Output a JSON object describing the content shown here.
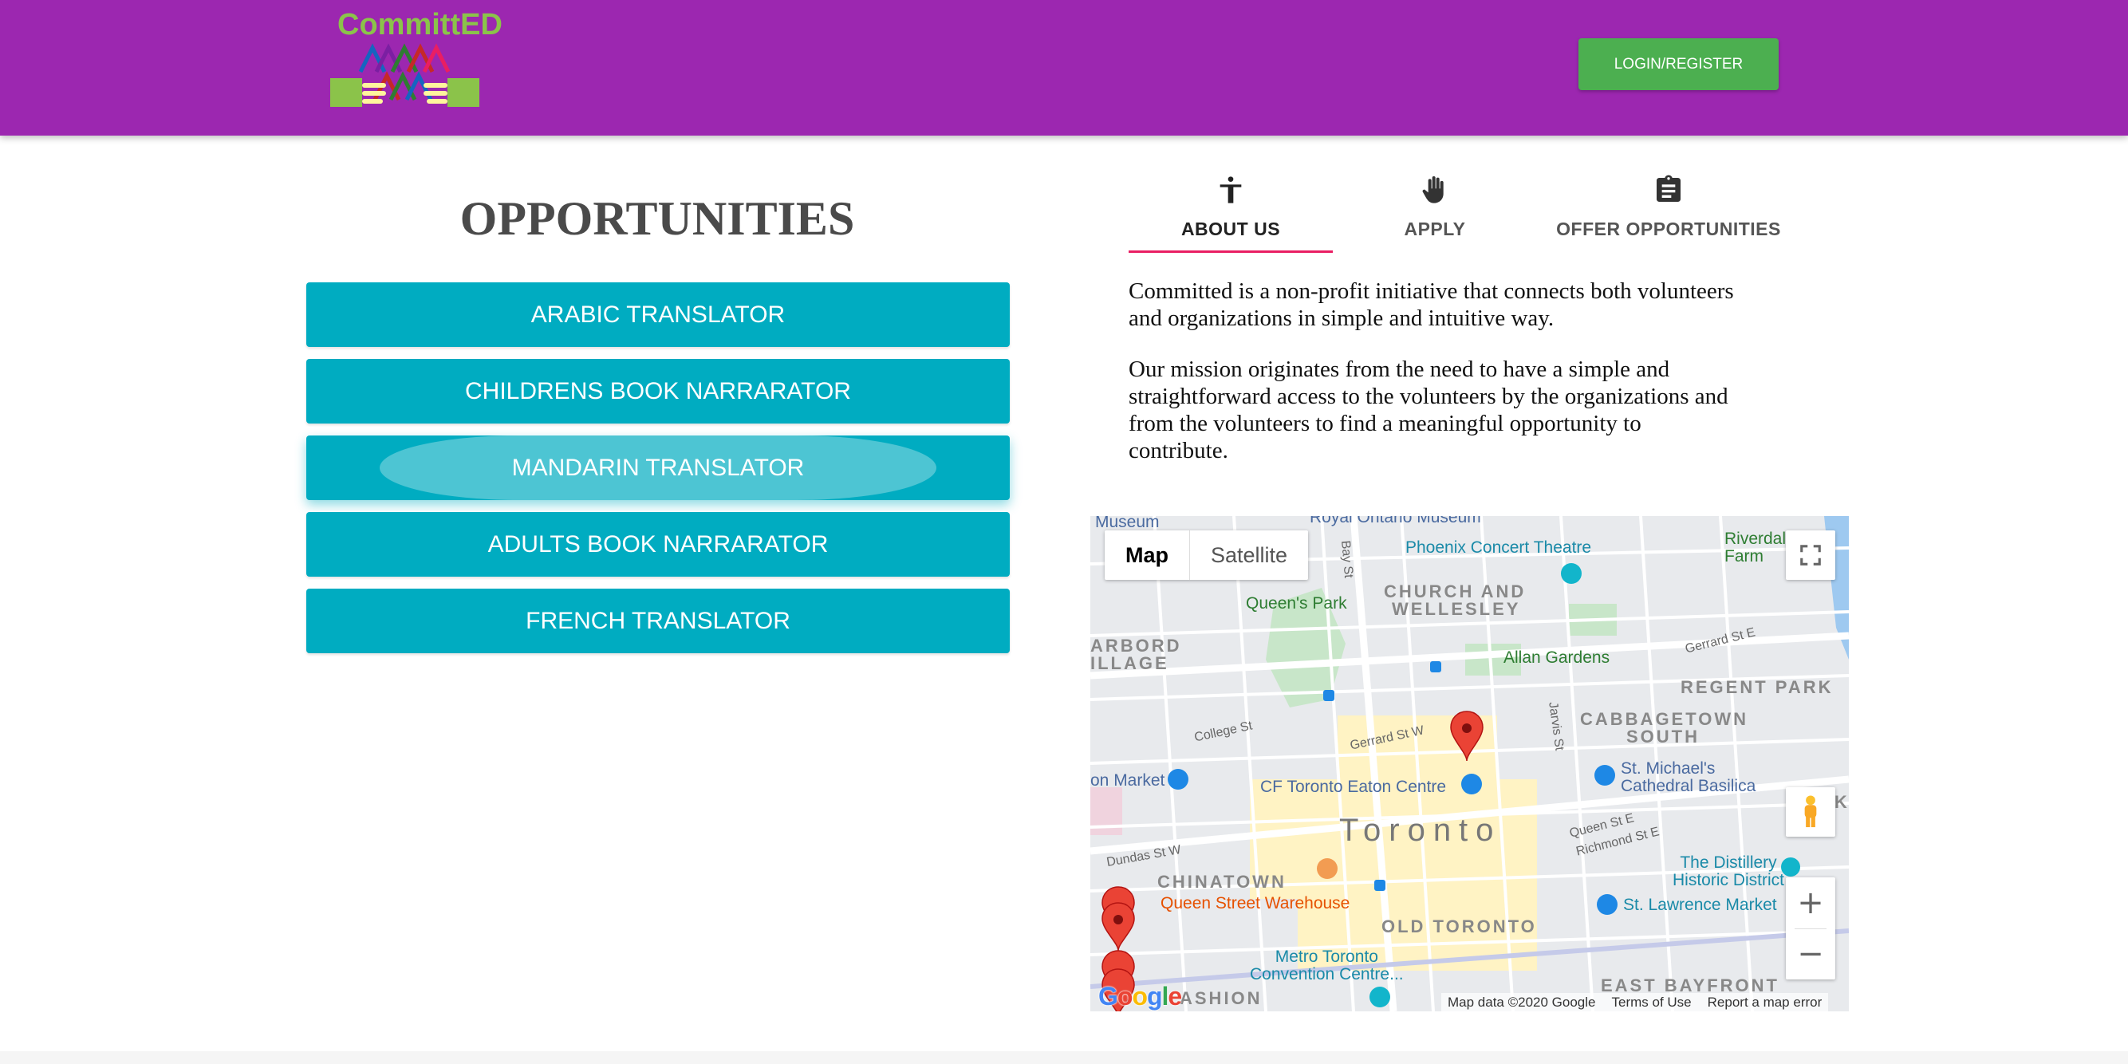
{
  "header": {
    "logo_text": "CommittED",
    "login_label": "LOGIN/REGISTER"
  },
  "opportunities": {
    "title": "OPPORTUNITIES",
    "items": [
      {
        "label": "ARABIC TRANSLATOR"
      },
      {
        "label": "CHILDRENS BOOK NARRARATOR"
      },
      {
        "label": "MANDARIN TRANSLATOR"
      },
      {
        "label": "ADULTS BOOK NARRARATOR"
      },
      {
        "label": "FRENCH TRANSLATOR"
      }
    ]
  },
  "tabs": [
    {
      "label": "ABOUT US",
      "icon": "accessibility-icon",
      "active": true
    },
    {
      "label": "APPLY",
      "icon": "hand-icon",
      "active": false
    },
    {
      "label": "OFFER OPPORTUNITIES",
      "icon": "clipboard-icon",
      "active": false
    }
  ],
  "about": {
    "p1": "Committed is a non-profit initiative that connects both volunteers and organizations in simple and intuitive way.",
    "p2": "Our mission originates from the need to have a simple and straightforward access to the volunteers by the organizations and from the volunteers to find a meaningful opportunity to contribute."
  },
  "map": {
    "type_map": "Map",
    "type_satellite": "Satellite",
    "city": "Toronto",
    "labels": {
      "museum": "Museum",
      "royal_ontario": "Royal Ontario Museum",
      "phoenix": "Phoenix Concert Theatre",
      "riverdale": "Riverdale Farm",
      "queens_park": "Queen's Park",
      "church_wellesley_1": "CHURCH AND",
      "church_wellesley_2": "WELLESLEY",
      "harbord_1": "ARBORD",
      "harbord_2": "ILLAGE",
      "allan_gardens": "Allan Gardens",
      "regent_park": "REGENT PARK",
      "cabbagetown_1": "CABBAGETOWN",
      "cabbagetown_2": "SOUTH",
      "market": "on Market",
      "eaton": "CF Toronto Eaton Centre",
      "st_michaels_1": "St. Michael's",
      "st_michaels_2": "Cathedral Basilica",
      "corktown": "CORKT",
      "chinatown": "CHINATOWN",
      "queen_street_warehouse": "Queen Street Warehouse",
      "distillery_1": "The Distillery",
      "distillery_2": "Historic District",
      "st_lawrence": "St. Lawrence Market",
      "old_toronto": "OLD TORONTO",
      "metro_1": "Metro Toronto",
      "metro_2": "Convention Centre...",
      "east_bayfront": "EAST BAYFRONT",
      "fashion": "ASHION",
      "bay_st": "Bay St",
      "college_st": "College St",
      "gerrard_w": "Gerrard St W",
      "gerrard_e": "Gerrard St E",
      "jarvis": "Jarvis St",
      "queen_e": "Queen St E",
      "richmond_e": "Richmond St E",
      "dundas_w": "Dundas St W"
    },
    "footer": {
      "data": "Map data ©2020 Google",
      "terms": "Terms of Use",
      "report": "Report a map error"
    },
    "google": "Google"
  },
  "colors": {
    "header": "#9c27b0",
    "login": "#4caf50",
    "opportunity": "#00acc1",
    "tab_indicator": "#e91e63"
  }
}
